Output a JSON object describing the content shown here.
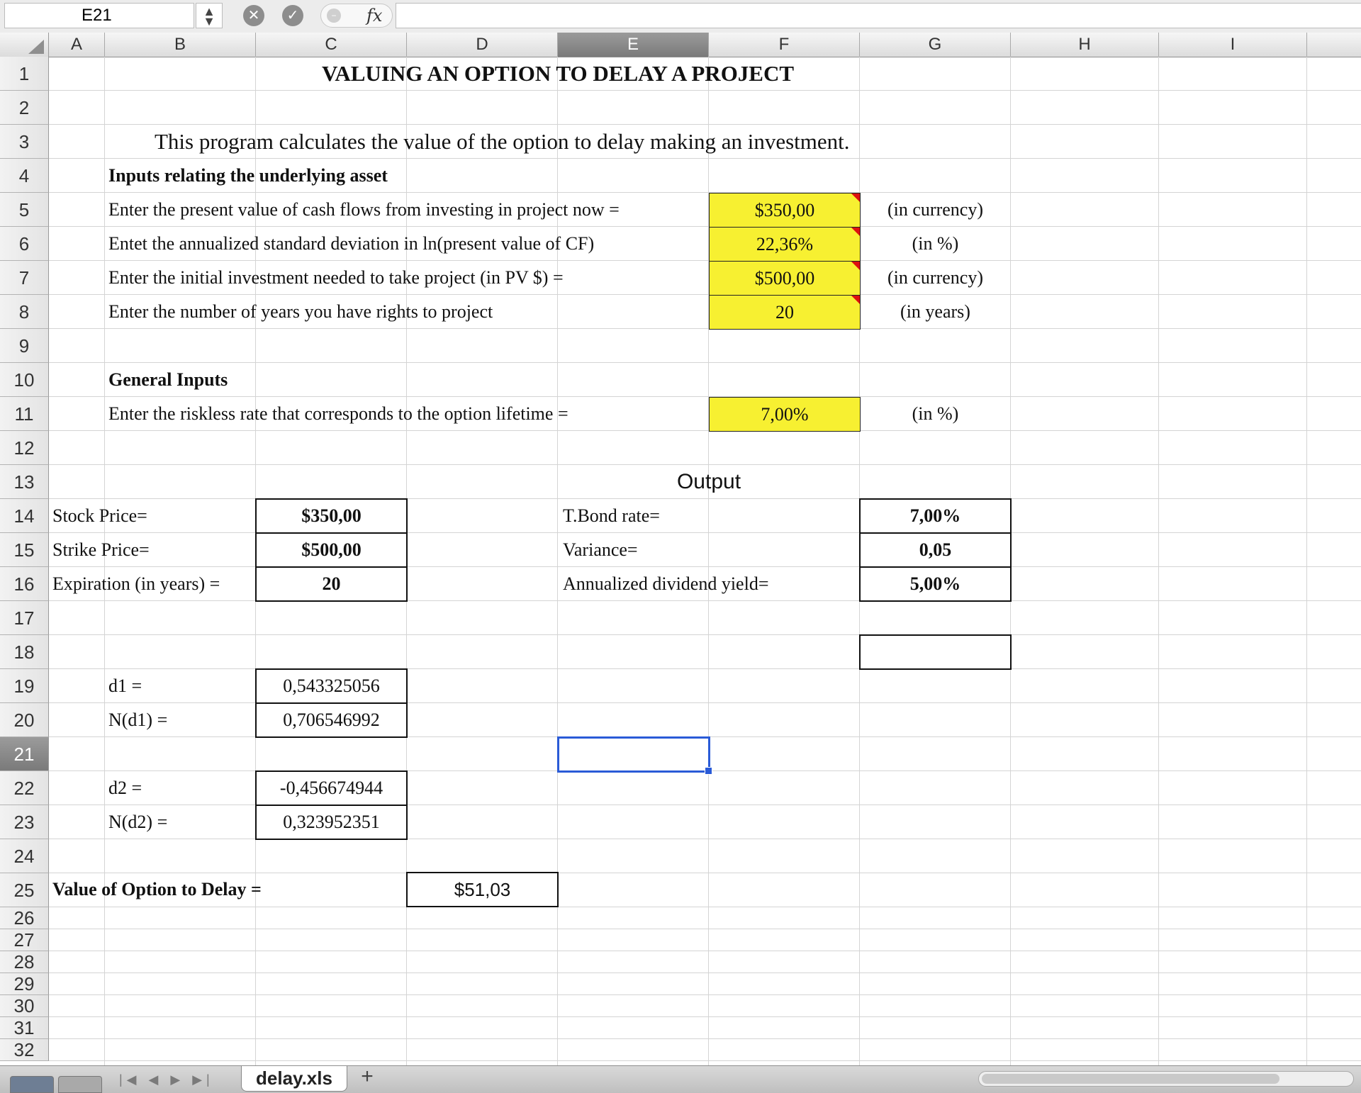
{
  "formula_bar": {
    "name_box": "E21",
    "stepper_icon": "up-down-arrows-icon",
    "cancel_icon": "x-circle-icon",
    "confirm_icon": "check-circle-icon",
    "function_icon": "function-icon",
    "fx_label": "fx",
    "formula": ""
  },
  "columns": [
    "A",
    "B",
    "C",
    "D",
    "E",
    "F",
    "G",
    "H",
    "I"
  ],
  "active_column": "E",
  "rows": [
    "1",
    "2",
    "3",
    "4",
    "5",
    "6",
    "7",
    "8",
    "9",
    "10",
    "11",
    "12",
    "13",
    "14",
    "15",
    "16",
    "17",
    "18",
    "19",
    "20",
    "21",
    "22",
    "23",
    "24",
    "25",
    "26",
    "27",
    "28",
    "29",
    "30",
    "31",
    "32"
  ],
  "active_row": "21",
  "sheet": {
    "title": "VALUING AN OPTION TO DELAY A PROJECT",
    "description": "This program calculates the value of the option to delay making an investment.",
    "section_asset": "Inputs relating the underlying asset",
    "pv_label": "Enter the present value of cash flows from investing in project now =",
    "pv_value": "$350,00",
    "pv_unit": "(in currency)",
    "sd_label": "Entet the annualized standard deviation in ln(present value of CF)",
    "sd_value": "22,36%",
    "sd_unit": "(in %)",
    "inv_label": "Enter the initial investment needed to take project (in PV $) =",
    "inv_value": "$500,00",
    "inv_unit": "(in currency)",
    "years_label": "Enter the number of years you have rights to project",
    "years_value": "20",
    "years_unit": "(in years)",
    "section_general": "General Inputs",
    "rf_label": "Enter the riskless rate that corresponds to the option lifetime =",
    "rf_value": "7,00%",
    "rf_unit": "(in %)",
    "output_heading": "Output",
    "stock_label": "Stock Price=",
    "stock_value": "$350,00",
    "strike_label": "Strike Price=",
    "strike_value": "$500,00",
    "expiry_label": "Expiration (in years) =",
    "expiry_value": "20",
    "tbond_label": "T.Bond rate=",
    "tbond_value": "7,00%",
    "variance_label": "Variance=",
    "variance_value": "0,05",
    "yield_label": "Annualized dividend yield=",
    "yield_value": "5,00%",
    "d1_label": "d1 =",
    "d1_value": "0,543325056",
    "nd1_label": "N(d1) =",
    "nd1_value": "0,706546992",
    "d2_label": "d2 =",
    "d2_value": "-0,456674944",
    "nd2_label": "N(d2) =",
    "nd2_value": "0,323952351",
    "option_label": "Value of Option to Delay =",
    "option_value": "$51,03"
  },
  "bottom_bar": {
    "nav_arrows": "|◀ ◀ ▶ ▶|",
    "sheet_tab": "delay.xls",
    "add_tab": "+"
  },
  "colors": {
    "input_fill": "#f7f031",
    "selection": "#2a5bd7",
    "comment_marker": "#d11111"
  }
}
